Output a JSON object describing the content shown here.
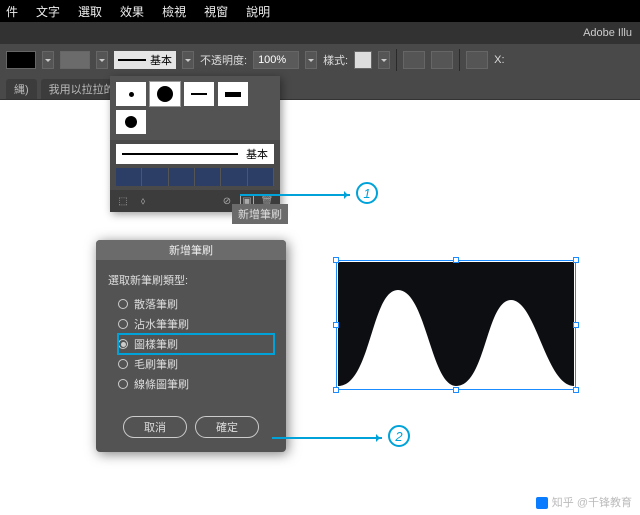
{
  "menu": {
    "items": [
      "件",
      "文字",
      "選取",
      "效果",
      "檢視",
      "視窗",
      "說明"
    ]
  },
  "app": {
    "title": "Adobe Illu"
  },
  "control": {
    "basic": "基本",
    "opacity_label": "不透明度:",
    "opacity_value": "100%",
    "style_label": "樣式:",
    "x_label": "X:"
  },
  "tabs": {
    "doc1": "我用以拉拉的..."
  },
  "brushes": {
    "basic_label": "基本",
    "tooltip": "新增筆刷"
  },
  "dialog": {
    "title": "新增筆刷",
    "prompt": "選取新筆刷類型:",
    "options": [
      "散落筆刷",
      "沾水筆筆刷",
      "圖樣筆刷",
      "毛刷筆刷",
      "線條圖筆刷"
    ],
    "cancel": "取消",
    "ok": "確定"
  },
  "annotations": {
    "step1": "1",
    "step2": "2"
  },
  "watermark": {
    "text": "知乎 @千锋教育"
  }
}
